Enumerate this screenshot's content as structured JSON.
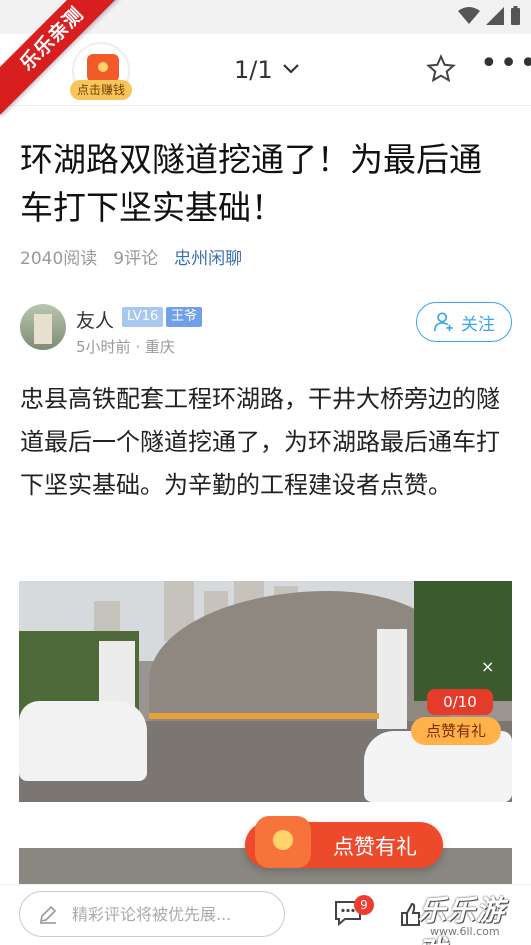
{
  "status_bar": {},
  "watermark": {
    "ribbon_text": "乐乐亲测"
  },
  "header": {
    "earn_label": "点击赚钱",
    "page_indicator": "1/1"
  },
  "article": {
    "title": "环湖路双隧道挖通了！为最后通车打下坚实基础！",
    "reads": "2040阅读",
    "comments": "9评论",
    "channel": "忠州闲聊",
    "author": {
      "name": "友人",
      "level": "LV16",
      "badge": "王爷",
      "time": "5小时前",
      "location": "重庆",
      "follow_label": "关注"
    },
    "body": "忠县高铁配套工程环湖路，干井大桥旁边的隧道最后一个隧道挖通了，为环湖路最后通车打下坚实基础。为辛勤的工程建设者点赞。",
    "photo": {
      "like_counter": "0/10",
      "like_reward": "点赞有礼",
      "close_symbol": "×"
    }
  },
  "promo": {
    "text": "点赞有礼"
  },
  "bottom_bar": {
    "comment_placeholder": "精彩评论将被优先展...",
    "comment_count": "9",
    "site_logo": "乐乐游戏",
    "site_url": "www.6ll.com"
  },
  "colors": {
    "accent_blue": "#3aa5ee",
    "channel_blue": "#3a6fb0",
    "promo_red": "#ed4a2c",
    "ribbon_red": "#d81e1e"
  },
  "icons": [
    "back-icon",
    "chevron-down-icon",
    "star-icon",
    "more-icon",
    "person-plus-icon",
    "close-icon",
    "pen-icon",
    "comment-icon",
    "like-icon",
    "wifi-icon",
    "signal-icon",
    "battery-icon"
  ]
}
